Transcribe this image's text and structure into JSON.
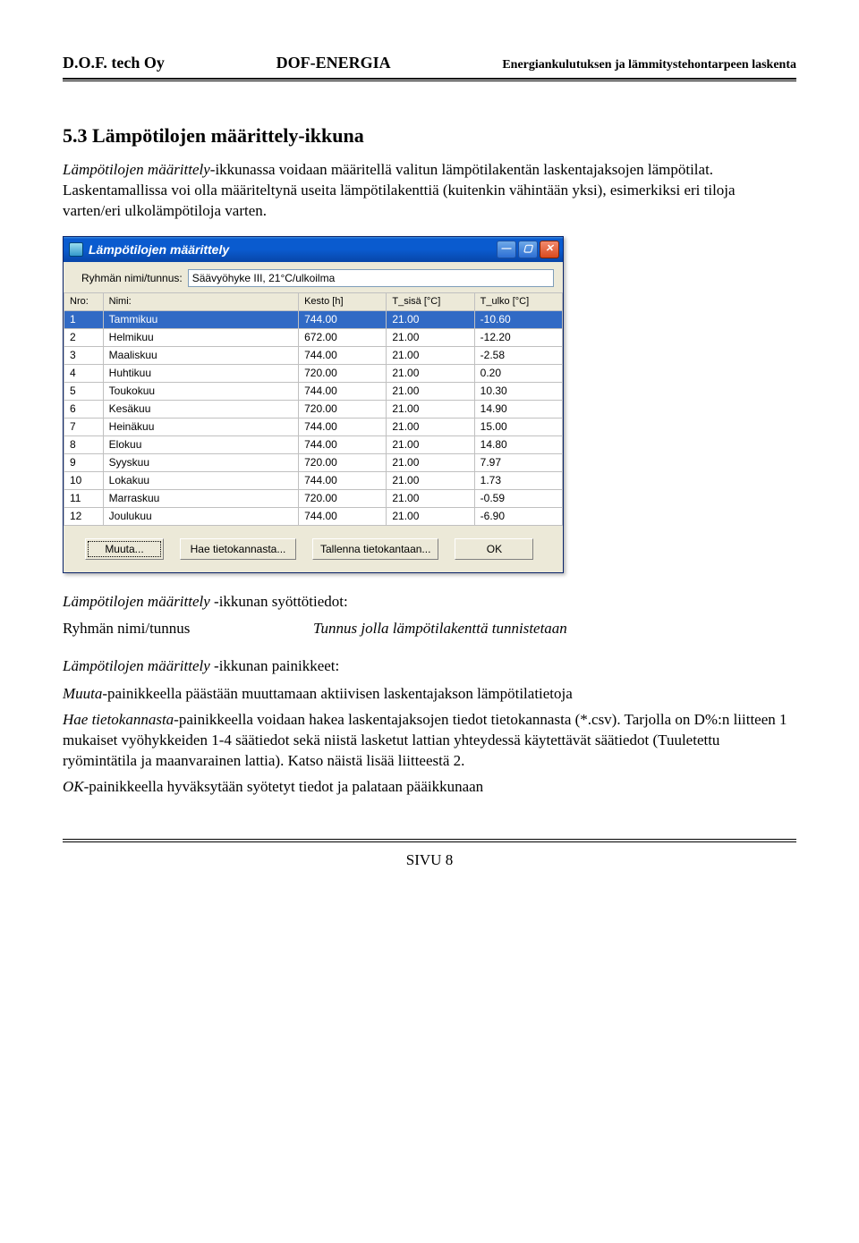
{
  "header": {
    "left": "D.O.F. tech Oy",
    "center": "DOF-ENERGIA",
    "right": "Energiankulutuksen ja lämmitystehontarpeen laskenta"
  },
  "section_title": "5.3 Lämpötilojen määrittely-ikkuna",
  "intro_1_prefix": "Lämpötilojen määrittely",
  "intro_1_rest": "-ikkunassa voidaan määritellä valitun lämpötilakentän laskentajaksojen lämpötilat. Laskentamallissa voi olla määriteltynä useita lämpötilakenttiä (kuitenkin vähintään yksi), esimerkiksi eri tiloja varten/eri ulkolämpötiloja varten.",
  "dialog": {
    "title": "Lämpötilojen määrittely",
    "group_label": "Ryhmän nimi/tunnus:",
    "group_value": "Säävyöhyke III, 21°C/ulkoilma",
    "headers": {
      "nro": "Nro:",
      "name": "Nimi:",
      "duration": "Kesto [h]",
      "t_in": "T_sisä [°C]",
      "t_out": "T_ulko [°C]"
    },
    "rows": [
      {
        "n": "1",
        "name": "Tammikuu",
        "dur": "744.00",
        "tin": "21.00",
        "tout": "-10.60"
      },
      {
        "n": "2",
        "name": "Helmikuu",
        "dur": "672.00",
        "tin": "21.00",
        "tout": "-12.20"
      },
      {
        "n": "3",
        "name": "Maaliskuu",
        "dur": "744.00",
        "tin": "21.00",
        "tout": "-2.58"
      },
      {
        "n": "4",
        "name": "Huhtikuu",
        "dur": "720.00",
        "tin": "21.00",
        "tout": "0.20"
      },
      {
        "n": "5",
        "name": "Toukokuu",
        "dur": "744.00",
        "tin": "21.00",
        "tout": "10.30"
      },
      {
        "n": "6",
        "name": "Kesäkuu",
        "dur": "720.00",
        "tin": "21.00",
        "tout": "14.90"
      },
      {
        "n": "7",
        "name": "Heinäkuu",
        "dur": "744.00",
        "tin": "21.00",
        "tout": "15.00"
      },
      {
        "n": "8",
        "name": "Elokuu",
        "dur": "744.00",
        "tin": "21.00",
        "tout": "14.80"
      },
      {
        "n": "9",
        "name": "Syyskuu",
        "dur": "720.00",
        "tin": "21.00",
        "tout": "7.97"
      },
      {
        "n": "10",
        "name": "Lokakuu",
        "dur": "744.00",
        "tin": "21.00",
        "tout": "1.73"
      },
      {
        "n": "11",
        "name": "Marraskuu",
        "dur": "720.00",
        "tin": "21.00",
        "tout": "-0.59"
      },
      {
        "n": "12",
        "name": "Joulukuu",
        "dur": "744.00",
        "tin": "21.00",
        "tout": "-6.90"
      }
    ],
    "buttons": {
      "change": "Muuta...",
      "fetch": "Hae tietokannasta...",
      "save": "Tallenna tietokantaan...",
      "ok": "OK"
    }
  },
  "inputs_heading_prefix": "Lämpötilojen määrittely",
  "inputs_heading_suffix": " -ikkunan syöttötiedot:",
  "kv": {
    "key": "Ryhmän nimi/tunnus",
    "val": "Tunnus jolla lämpötilakenttä tunnistetaan"
  },
  "buttons_heading_prefix": "Lämpötilojen määrittely",
  "buttons_heading_suffix": " -ikkunan painikkeet:",
  "para1_a": "Muuta",
  "para1_b": "-painikkeella päästään muuttamaan aktiivisen laskentajakson lämpötilatietoja",
  "para2_a": "Hae tietokannasta",
  "para2_b": "-painikkeella voidaan hakea laskentajaksojen tiedot tietokannasta (*.csv). Tarjolla on D%:n liitteen 1 mukaiset vyöhykkeiden 1-4 säätiedot sekä niistä lasketut lattian yhteydessä käytettävät säätiedot (Tuuletettu ryömintätila ja maanvarainen lattia). Katso näistä lisää liitteestä 2.",
  "para3_a": "OK",
  "para3_b": "-painikkeella hyväksytään syötetyt tiedot ja palataan pääikkunaan",
  "footer": "SIVU 8"
}
